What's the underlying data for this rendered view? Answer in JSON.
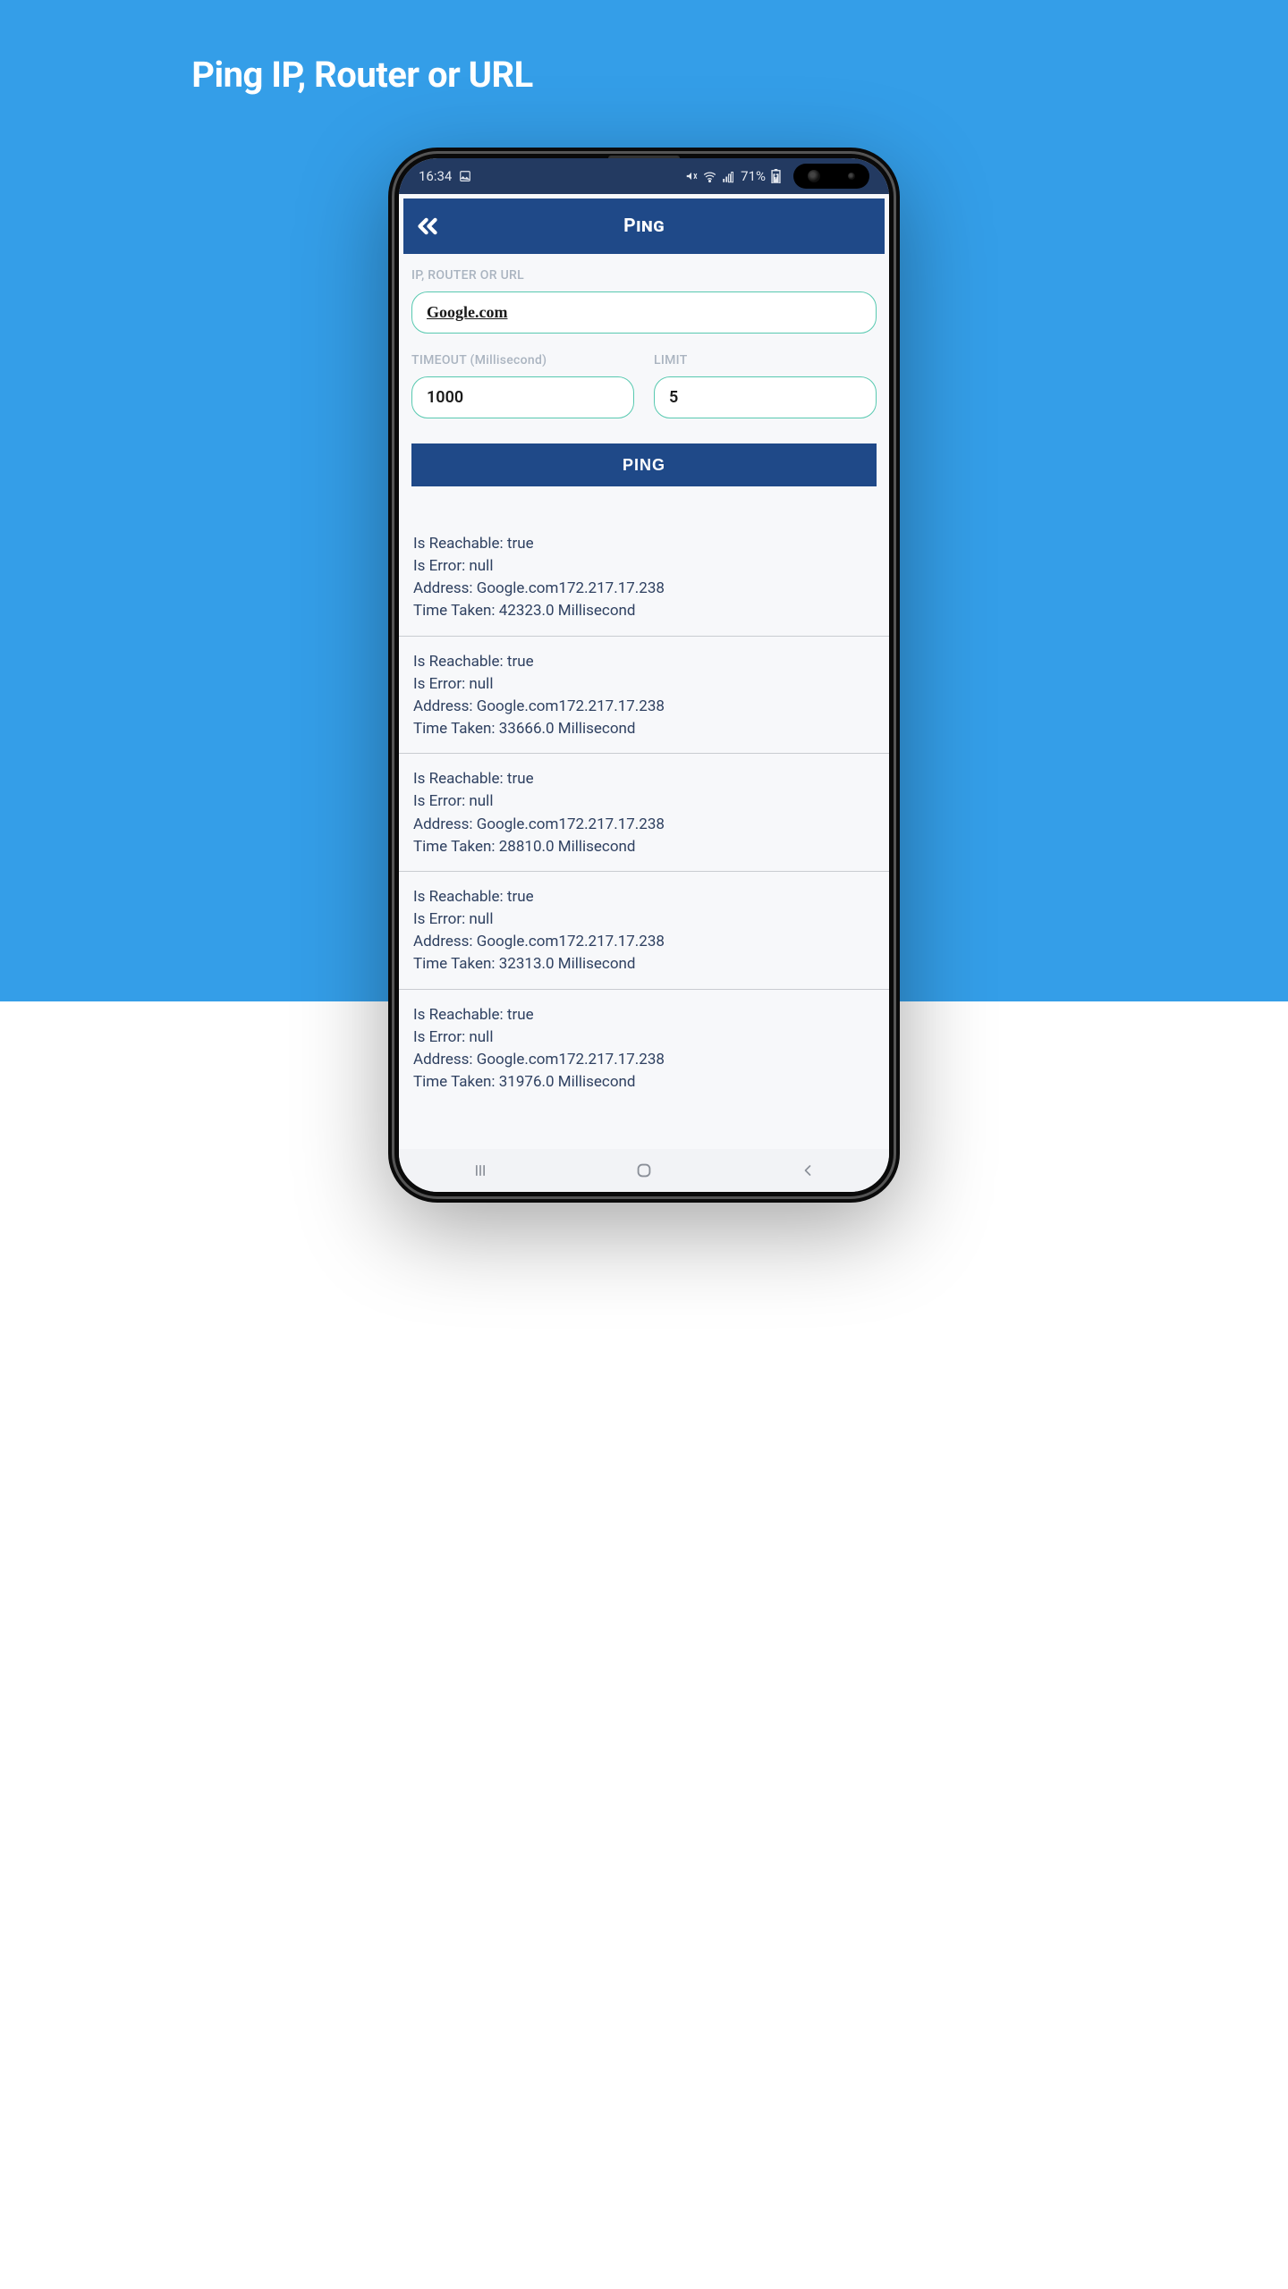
{
  "promo": {
    "title": "Ping IP, Router or URL"
  },
  "statusbar": {
    "time": "16:34",
    "battery": "71%"
  },
  "titlebar": {
    "title": "Ping"
  },
  "form": {
    "url_label": "IP, ROUTER OR URL",
    "url_value": "Google.com",
    "timeout_label": "TIMEOUT (Millisecond)",
    "timeout_value": "1000",
    "limit_label": "LIMIT",
    "limit_value": "5",
    "ping_button": "PING"
  },
  "result_labels": {
    "reachable": "Is Reachable: ",
    "error": "Is Error: ",
    "address": "Address: ",
    "time": "Time Taken: "
  },
  "results": [
    {
      "reachable": "true",
      "error": "null",
      "address": "Google.com172.217.17.238",
      "time": "42323.0 Millisecond"
    },
    {
      "reachable": "true",
      "error": "null",
      "address": "Google.com172.217.17.238",
      "time": "33666.0 Millisecond"
    },
    {
      "reachable": "true",
      "error": "null",
      "address": "Google.com172.217.17.238",
      "time": "28810.0 Millisecond"
    },
    {
      "reachable": "true",
      "error": "null",
      "address": "Google.com172.217.17.238",
      "time": "32313.0 Millisecond"
    },
    {
      "reachable": "true",
      "error": "null",
      "address": "Google.com172.217.17.238",
      "time": "31976.0 Millisecond"
    }
  ]
}
